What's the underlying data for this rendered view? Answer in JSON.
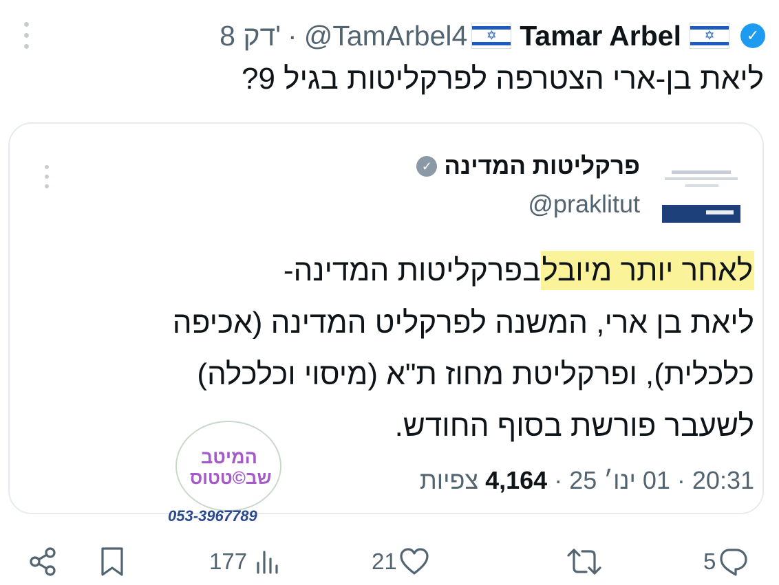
{
  "tweet": {
    "display_name": "Tamar Arbel",
    "handle": "@TamArbel4",
    "separator": "·",
    "time": "8 דק'",
    "flag_icon": "israel-flag",
    "verified_icon": "verified-badge",
    "text": "ליאת בן-ארי הצטרפה לפרקליטות בגיל 9?"
  },
  "quote": {
    "name": "פרקליטות המדינה",
    "handle": "@praklitut",
    "body": {
      "line1_highlight": "לאחר יותר מיובל",
      "line1_rest": "בפרקליטות המדינה-",
      "line2": "ליאת בן ארי, המשנה לפרקליט המדינה (אכיפה",
      "line3": "כלכלית), ופרקליטת מחוז ת\"א (מיסוי וכלכלה)",
      "line4": "לשעבר פורשת בסוף החודש."
    },
    "highlight_color": "#faf39a",
    "meta": {
      "time": "20:31",
      "date": "01 ינו׳ 25",
      "views_count": "4,164",
      "views_label": "צפיות",
      "dot": "·"
    }
  },
  "watermark": {
    "line1": "המיטב",
    "line2": "שב©טטוס",
    "phone": "053-3967789"
  },
  "actions": {
    "replies": "5",
    "retweets": "",
    "likes": "21",
    "views": "177"
  },
  "colors": {
    "verified_blue": "#1d9bf0",
    "muted_text": "#536471",
    "watermark_purple": "#a45bc9"
  }
}
